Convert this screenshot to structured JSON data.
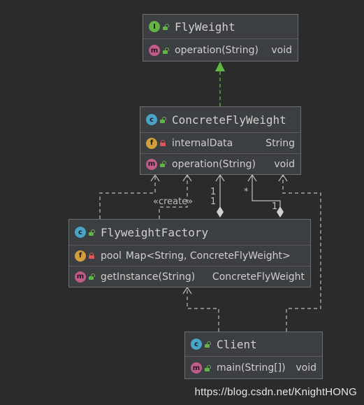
{
  "colors": {
    "background": "#2b2b2b",
    "box": "#3c3f41",
    "interface_badge": "#62b543",
    "class_badge": "#4aa3c9",
    "field_badge": "#d29e3b",
    "method_badge": "#c25a8a",
    "line": "#bdbdbd",
    "realization_arrow": "#62b543"
  },
  "classes": {
    "flyweight": {
      "badge": "I",
      "badge_icon": "interface-icon",
      "name": "FlyWeight",
      "members": [
        {
          "kind": "method",
          "badge": "m",
          "visibility": "public",
          "name": "operation(String)",
          "type": "void"
        }
      ]
    },
    "concrete": {
      "badge": "c",
      "badge_icon": "class-icon",
      "name": "ConcreteFlyWeight",
      "members": [
        {
          "kind": "field",
          "badge": "f",
          "visibility": "private",
          "name": "internalData",
          "type": "String"
        },
        {
          "kind": "method",
          "badge": "m",
          "visibility": "public",
          "name": "operation(String)",
          "type": "void"
        }
      ]
    },
    "factory": {
      "badge": "c",
      "badge_icon": "class-icon",
      "name": "FlyweightFactory",
      "members": [
        {
          "kind": "field",
          "badge": "f",
          "visibility": "private",
          "name": "pool",
          "type": "Map<String, ConcreteFlyWeight>"
        },
        {
          "kind": "method",
          "badge": "m",
          "visibility": "public",
          "name": "getInstance(String)",
          "type": "ConcreteFlyWeight"
        }
      ]
    },
    "client": {
      "badge": "c",
      "badge_icon": "class-icon",
      "name": "Client",
      "members": [
        {
          "kind": "method",
          "badge": "m",
          "visibility": "public",
          "name": "main(String[])",
          "type": "void"
        }
      ]
    }
  },
  "relations": {
    "create_label": "«create»",
    "mult_a1": "1",
    "mult_a2": "1",
    "mult_b1": "*",
    "mult_b2": "1"
  },
  "watermark": "https://blog.csdn.net/KnightHONG"
}
